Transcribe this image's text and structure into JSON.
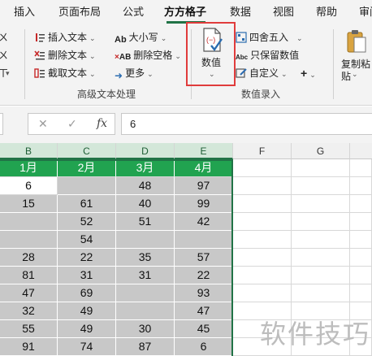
{
  "ribbon_tabs": [
    "插入",
    "页面布局",
    "公式",
    "方方格子",
    "数据",
    "视图",
    "帮助",
    "审阅"
  ],
  "active_tab": "方方格子",
  "ribbon": {
    "left_edge_glyphs": [
      "ㄨ",
      "ㄨ",
      "ㄒ"
    ],
    "insert_text": "插入文本",
    "delete_text": "删除文本",
    "cut_text": "截取文本",
    "case": "大小写",
    "delete_space": "删除空格",
    "more": "更多",
    "group_advanced_text": "高级文本处理",
    "numeric": "数值",
    "round": "四舍五入",
    "keep_numeric": "只保留数值",
    "custom": "自定义",
    "plus": "+",
    "group_numeric_entry": "数值录入",
    "copy_paste_line1": "复制粘",
    "copy_paste_line2": "贴"
  },
  "formula_bar": {
    "cancel_icon": "✕",
    "confirm_icon": "✓",
    "fx": "fx",
    "value": "6"
  },
  "columns": [
    "B",
    "C",
    "D",
    "E",
    "F",
    "G"
  ],
  "table": {
    "headers": [
      "1月",
      "2月",
      "3月",
      "4月"
    ],
    "rows": [
      [
        "6",
        "",
        "48",
        "97"
      ],
      [
        "15",
        "61",
        "40",
        "99"
      ],
      [
        "",
        "52",
        "51",
        "42"
      ],
      [
        "",
        "54",
        "",
        ""
      ],
      [
        "28",
        "22",
        "35",
        "57"
      ],
      [
        "81",
        "31",
        "31",
        "22"
      ],
      [
        "47",
        "69",
        "",
        "93"
      ],
      [
        "32",
        "49",
        "",
        "47"
      ],
      [
        "55",
        "49",
        "30",
        "45"
      ],
      [
        "91",
        "74",
        "87",
        "6"
      ]
    ]
  },
  "watermark": "软件技巧",
  "colors": {
    "accent_green": "#217346",
    "header_green": "#21a350",
    "null_gray": "#c8c8c8",
    "highlight_red": "#e03c3c"
  }
}
